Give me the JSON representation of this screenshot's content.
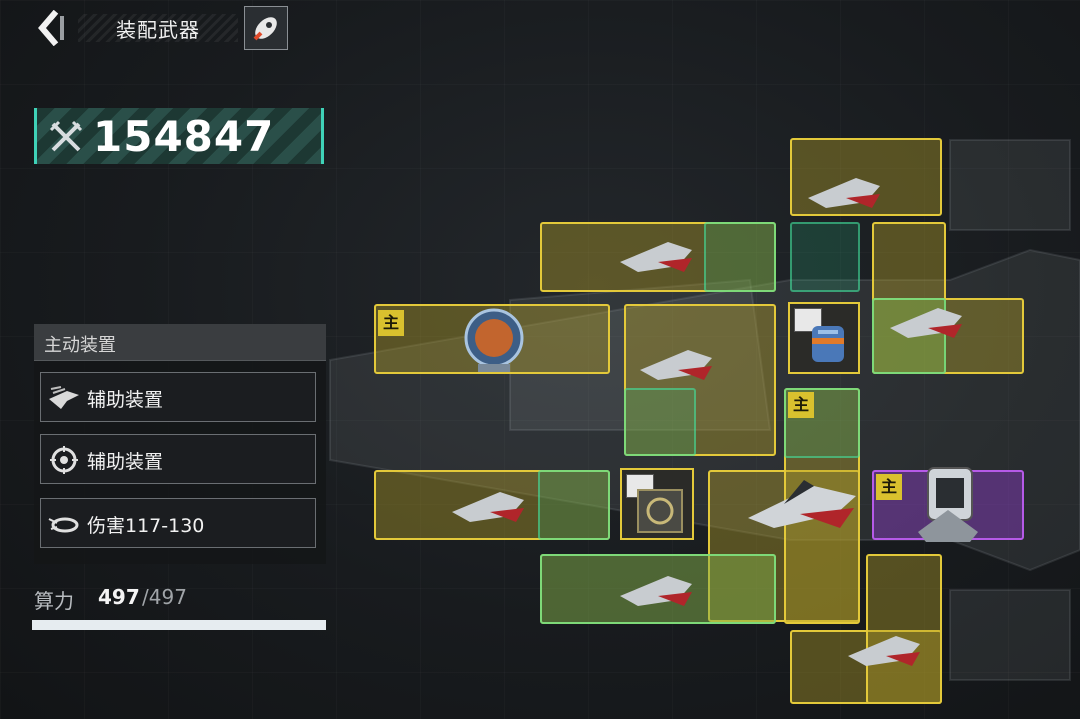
{
  "header": {
    "title": "装配武器"
  },
  "power": {
    "value": "154847"
  },
  "devices": {
    "header": "主动装置",
    "items": [
      {
        "label": "辅助装置",
        "icon": "squadron-icon"
      },
      {
        "label": "辅助装置",
        "icon": "target-reticle-icon"
      },
      {
        "label": "伤害117-130",
        "icon": "drone-icon"
      }
    ]
  },
  "compute": {
    "label": "算力",
    "used": "497",
    "total": "/497",
    "fraction": 1.0
  },
  "slots": {
    "main_tag": "主"
  },
  "colors": {
    "accent": "#3fd2b8",
    "slot_yellow": "#e3c93a",
    "slot_purple": "#b65ae8"
  }
}
